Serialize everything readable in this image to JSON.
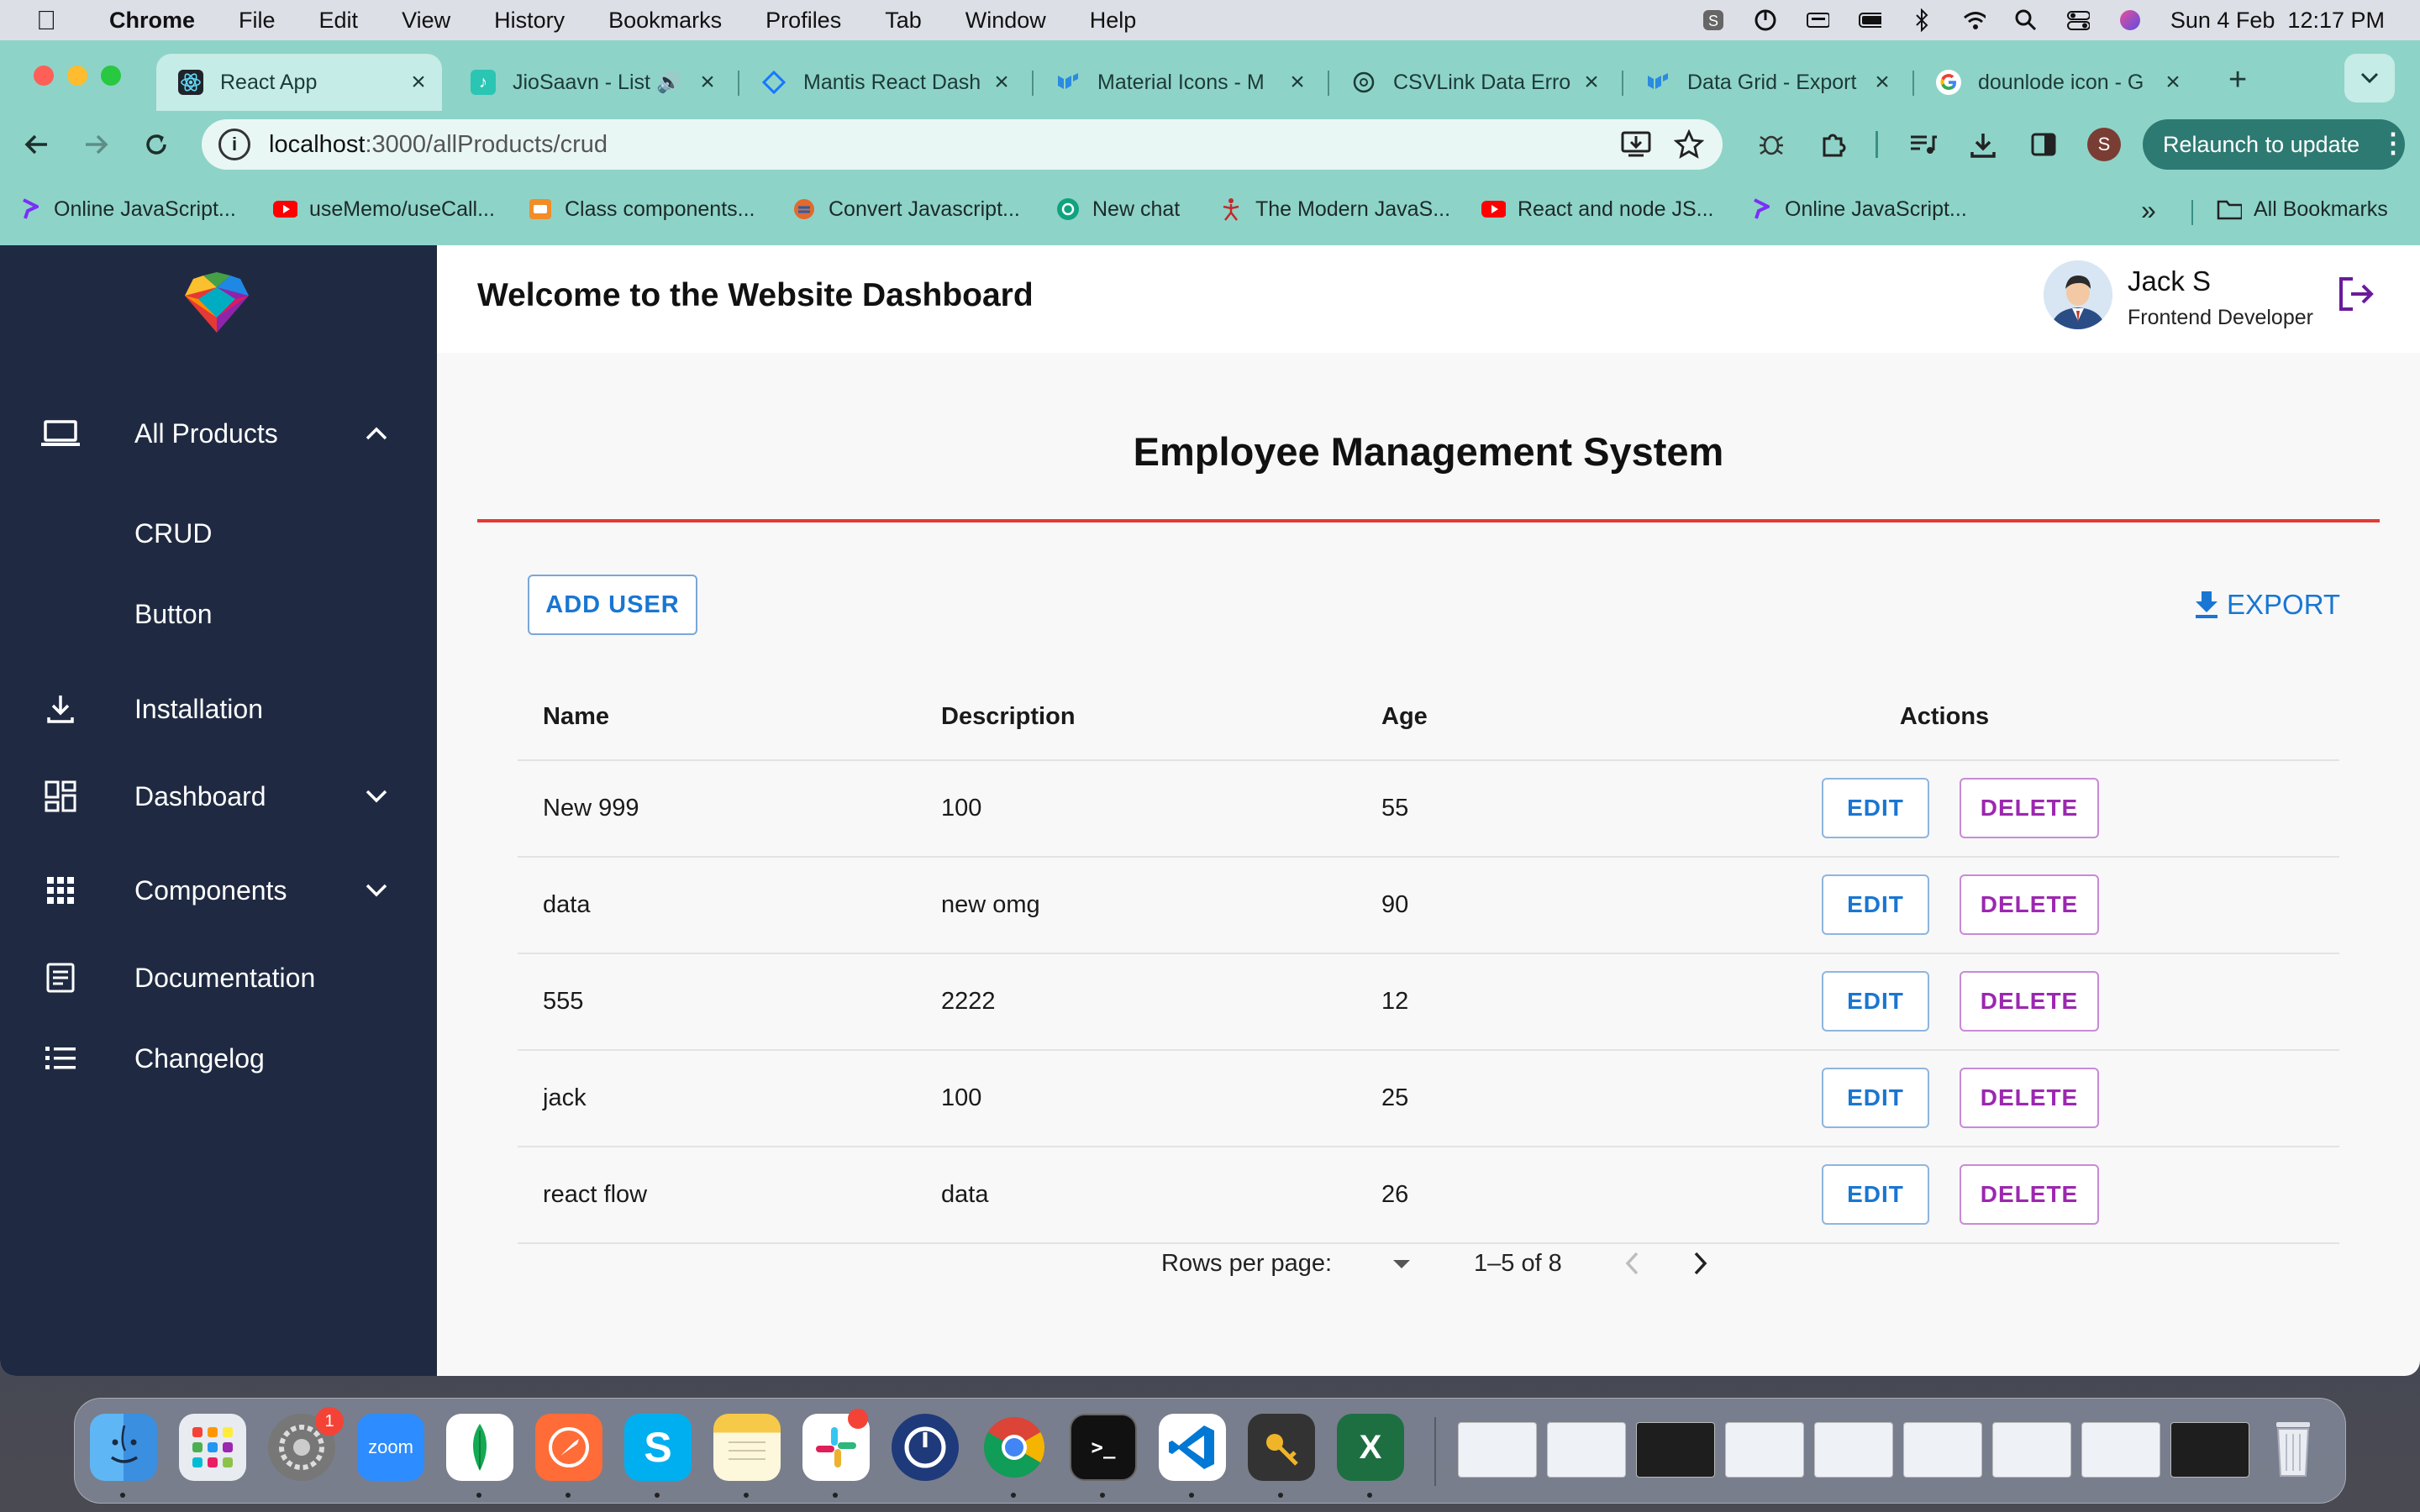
{
  "menubar": {
    "app": "Chrome",
    "items": [
      "File",
      "Edit",
      "View",
      "History",
      "Bookmarks",
      "Profiles",
      "Tab",
      "Window",
      "Help"
    ],
    "datetime": "Sun 4 Feb  12:17 PM"
  },
  "browser": {
    "tabs": [
      {
        "title": "React App"
      },
      {
        "title": "JioSaavn - List"
      },
      {
        "title": "Mantis React Dash"
      },
      {
        "title": "Material Icons - M"
      },
      {
        "title": "CSVLink Data Erro"
      },
      {
        "title": "Data Grid - Export"
      },
      {
        "title": "dounlode icon - G"
      }
    ],
    "url_host": "localhost",
    "url_path": ":3000/allProducts/crud",
    "relaunch_label": "Relaunch to update",
    "profile_initial": "S",
    "bookmarks": [
      "Online JavaScript...",
      "useMemo/useCall...",
      "Class components...",
      "Convert Javascript...",
      "New chat",
      "The Modern JavaS...",
      "React and node JS...",
      "Online JavaScript..."
    ],
    "all_bookmarks": "All Bookmarks"
  },
  "sidebar": {
    "all_products": "All Products",
    "sub_items": [
      "CRUD",
      "Button"
    ],
    "items": [
      {
        "label": "Installation"
      },
      {
        "label": "Dashboard"
      },
      {
        "label": "Components"
      },
      {
        "label": "Documentation"
      },
      {
        "label": "Changelog"
      }
    ]
  },
  "header": {
    "welcome": "Welcome to the Website Dashboard",
    "user_name": "Jack S",
    "user_role": "Frontend Developer"
  },
  "main": {
    "title": "Employee Management System",
    "add_user": "ADD USER",
    "export": "EXPORT",
    "columns": [
      "Name",
      "Description",
      "Age",
      "Actions"
    ],
    "rows": [
      {
        "name": "New 999",
        "description": "100",
        "age": "55"
      },
      {
        "name": "data",
        "description": "new omg",
        "age": "90"
      },
      {
        "name": "555",
        "description": "2222",
        "age": "12"
      },
      {
        "name": "jack",
        "description": "100",
        "age": "25"
      },
      {
        "name": "react flow",
        "description": "data",
        "age": "26"
      }
    ],
    "edit_label": "EDIT",
    "delete_label": "DELETE",
    "pagination": {
      "rows_per_page_label": "Rows per page:",
      "range": "1–5 of 8"
    }
  },
  "dock": {
    "zoom_label": "zoom",
    "settings_badge": "1"
  },
  "colors": {
    "sidebar_bg": "#1f2a42",
    "accent_blue": "#1976d2",
    "accent_purple": "#9c27b0",
    "divider_red": "#e53935",
    "chrome_theme": "#8ed3c8"
  }
}
